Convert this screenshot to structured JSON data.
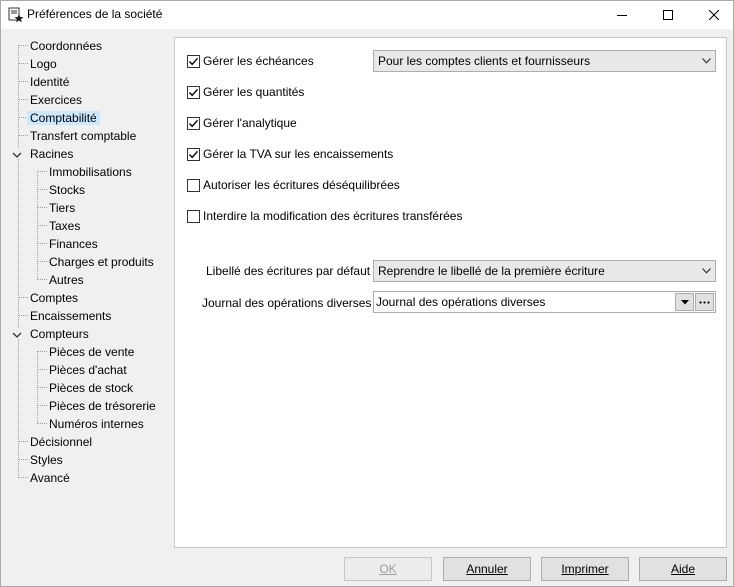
{
  "window": {
    "title": "Préférences de la société",
    "icon": "settings-star-icon"
  },
  "tree": {
    "items": [
      {
        "label": "Coordonnées"
      },
      {
        "label": "Logo"
      },
      {
        "label": "Identité"
      },
      {
        "label": "Exercices"
      },
      {
        "label": "Comptabilité"
      },
      {
        "label": "Transfert comptable"
      },
      {
        "label": "Racines"
      },
      {
        "label": "Immobilisations"
      },
      {
        "label": "Stocks"
      },
      {
        "label": "Tiers"
      },
      {
        "label": "Taxes"
      },
      {
        "label": "Finances"
      },
      {
        "label": "Charges et produits"
      },
      {
        "label": "Autres"
      },
      {
        "label": "Comptes"
      },
      {
        "label": "Encaissements"
      },
      {
        "label": "Compteurs"
      },
      {
        "label": "Pièces de vente"
      },
      {
        "label": "Pièces d'achat"
      },
      {
        "label": "Pièces de stock"
      },
      {
        "label": "Pièces de trésorerie"
      },
      {
        "label": "Numéros internes"
      },
      {
        "label": "Décisionnel"
      },
      {
        "label": "Styles"
      },
      {
        "label": "Avancé"
      }
    ],
    "selected": "Comptabilité"
  },
  "options": {
    "echeances": {
      "label": "Gérer les échéances",
      "checked": true
    },
    "quantites": {
      "label": "Gérer les quantités",
      "checked": true
    },
    "analytique": {
      "label": "Gérer l'analytique",
      "checked": true
    },
    "tva": {
      "label": "Gérer la TVA sur les encaissements",
      "checked": true
    },
    "desequilibrees": {
      "label": "Autoriser les écritures déséquilibrées",
      "checked": false
    },
    "transferees": {
      "label": "Interdire la modification des écritures transférées",
      "checked": false
    }
  },
  "echeances_select": {
    "value": "Pour les comptes clients et fournisseurs"
  },
  "libelle": {
    "label": "Libellé des écritures par défaut",
    "value": "Reprendre le libellé de la première écriture"
  },
  "journal": {
    "label": "Journal des opérations diverses",
    "value": "Journal des opérations diverses"
  },
  "buttons": {
    "ok": "OK",
    "annuler": "Annuler",
    "imprimer": "Imprimer",
    "aide": "Aide"
  }
}
